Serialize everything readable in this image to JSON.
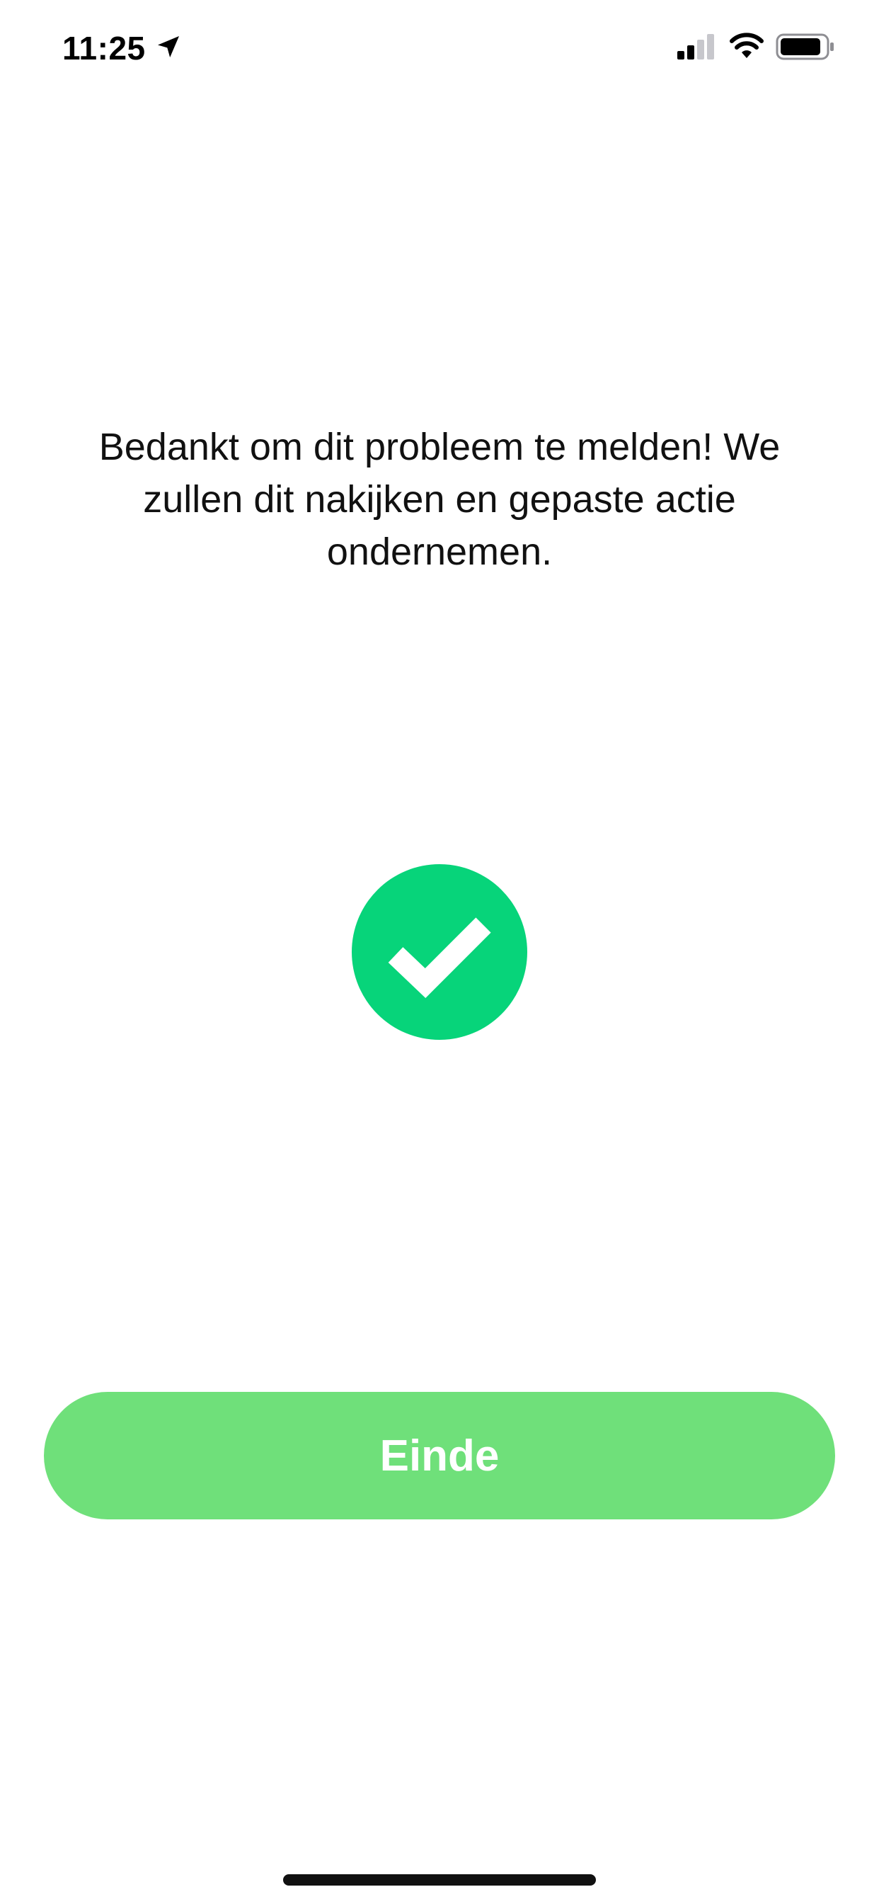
{
  "status_bar": {
    "time": "11:25",
    "icons": [
      "location-arrow-icon",
      "cellular-signal-icon",
      "wifi-icon",
      "battery-icon"
    ]
  },
  "message": "Bedankt om dit probleem te melden! We zullen dit nakijken en gepaste actie ondernemen.",
  "success_icon": "checkmark-circle-icon",
  "finish_button": {
    "label": "Einde"
  },
  "colors": {
    "success_green": "#07d47a",
    "button_green": "#6fe07a",
    "button_text": "#ffffff",
    "text": "#111111"
  }
}
